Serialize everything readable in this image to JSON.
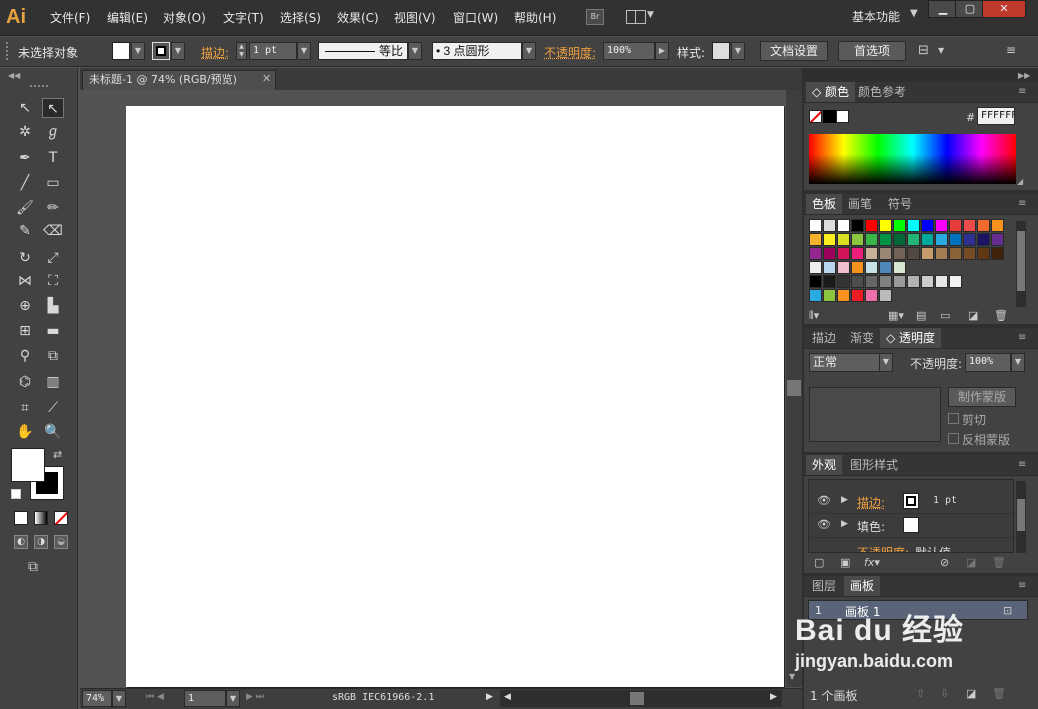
{
  "menubar": {
    "logo": "Ai",
    "items": [
      "文件(F)",
      "编辑(E)",
      "对象(O)",
      "文字(T)",
      "选择(S)",
      "效果(C)",
      "视图(V)",
      "窗口(W)",
      "帮助(H)"
    ],
    "bridge_label": "Br",
    "workspace": "基本功能"
  },
  "control": {
    "selection": "未选择对象",
    "stroke_label": "描边:",
    "stroke_weight": "1 pt",
    "stroke_profile": "等比",
    "brush": "3 点圆形",
    "opacity_label": "不透明度:",
    "opacity_value": "100%",
    "style_label": "样式:",
    "doc_setup": "文档设置",
    "prefs": "首选项"
  },
  "document": {
    "tab_title": "未标题-1 @ 74% (RGB/预览)",
    "zoom": "74%",
    "page": "1",
    "profile": "sRGB IEC61966-2.1"
  },
  "color_panel": {
    "tabs": [
      "颜色",
      "颜色参考"
    ],
    "hex_label": "#",
    "hex": "FFFFFF"
  },
  "swatches_panel": {
    "tabs": [
      "色板",
      "画笔",
      "符号"
    ],
    "rows": [
      [
        "#ff0000",
        "#ffff00",
        "#00ff00",
        "#00ffff",
        "#0000ff",
        "#ff00ff",
        "#e83b3b",
        "#ed4c4c",
        "#f26a2e",
        "#f7931e"
      ],
      [
        "#f7b12b",
        "#fcee21",
        "#d9e021",
        "#8cc63f",
        "#39b54a",
        "#009245",
        "#006837",
        "#22b573",
        "#00a99d",
        "#29abe2",
        "#0071bc",
        "#2e3192",
        "#1b1464",
        "#662d91"
      ],
      [
        "#93278f",
        "#9e005d",
        "#d4145a",
        "#ed1e79",
        "#c7b299",
        "#998675",
        "#736357",
        "#534741",
        "#c69c6d",
        "#a67c52",
        "#8c6239",
        "#754c24",
        "#603813",
        "#42210b"
      ],
      [
        "#eeeeee",
        "#b8d6f0",
        "#f0c0d0",
        "#f7931e",
        "#c8e0e8",
        "#4f88b8",
        "#d8e8d0"
      ],
      [
        "#000000",
        "#1a1a1a",
        "#333333",
        "#4d4d4d",
        "#666666",
        "#808080",
        "#999999",
        "#b3b3b3",
        "#cccccc",
        "#e6e6e6",
        "#f2f2f2"
      ],
      [
        "#29abe2",
        "#8cc63f",
        "#f7931e",
        "#ed1c24",
        "#f06eaa",
        "#bbbbbb"
      ]
    ]
  },
  "transparency_panel": {
    "tabs": [
      "描边",
      "渐变",
      "透明度"
    ],
    "blend_mode": "正常",
    "opacity_label": "不透明度:",
    "opacity_value": "100%",
    "mask_btn": "制作蒙版",
    "clip_label": "剪切",
    "invert_label": "反相蒙版"
  },
  "appearance_panel": {
    "tabs": [
      "外观",
      "图形样式"
    ],
    "stroke_label": "描边:",
    "stroke_value": "1 pt",
    "fill_label": "填色:",
    "opacity_label": "不透明度:",
    "opacity_value": "默认值",
    "fx": "fx"
  },
  "artboards_panel": {
    "tabs": [
      "图层",
      "画板"
    ],
    "row_index": "1",
    "row_name": "画板 1",
    "count": "1 个画板"
  },
  "watermark": {
    "brand": "Bai du 经验",
    "url": "jingyan.baidu.com"
  }
}
